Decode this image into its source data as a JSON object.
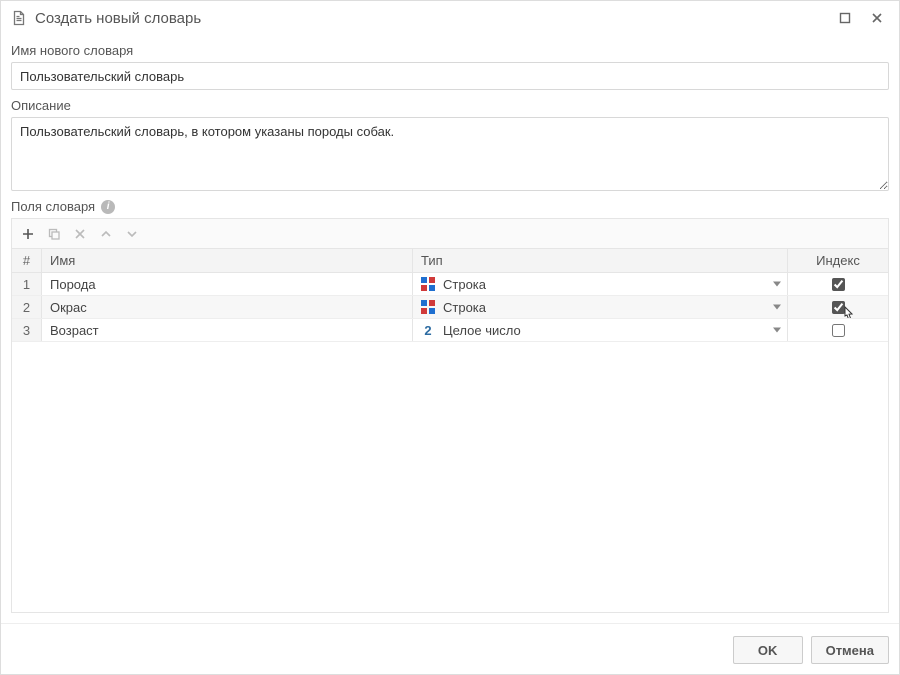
{
  "window": {
    "title": "Создать новый словарь"
  },
  "fields": {
    "name_label": "Имя нового словаря",
    "name_value": "Пользовательский словарь",
    "desc_label": "Описание",
    "desc_value": "Пользовательский словарь, в котором указаны породы собак.",
    "grid_label": "Поля словаря"
  },
  "grid": {
    "headers": {
      "num": "#",
      "name": "Имя",
      "type": "Тип",
      "index": "Индекс"
    },
    "rows": [
      {
        "num": "1",
        "name": "Порода",
        "type": "Строка",
        "type_kind": "string",
        "index": true,
        "hovered": false
      },
      {
        "num": "2",
        "name": "Окрас",
        "type": "Строка",
        "type_kind": "string",
        "index": true,
        "hovered": true
      },
      {
        "num": "3",
        "name": "Возраст",
        "type": "Целое число",
        "type_kind": "int",
        "index": false,
        "hovered": false
      }
    ]
  },
  "buttons": {
    "ok": "OK",
    "cancel": "Отмена"
  }
}
